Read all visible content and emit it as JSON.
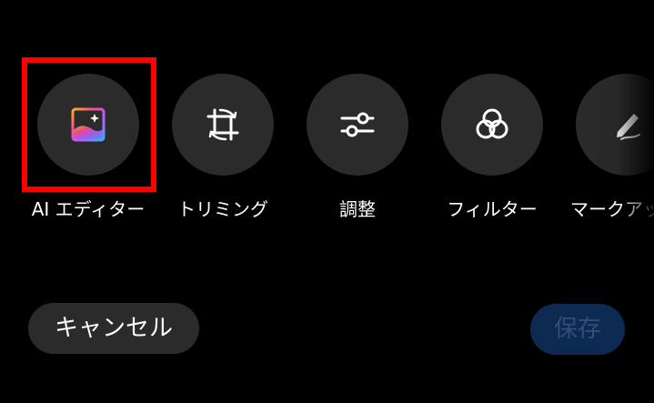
{
  "tools": [
    {
      "id": "ai-editor",
      "label": "AI エディター",
      "icon": "ai-image-sparkle-icon",
      "selected": true
    },
    {
      "id": "trimming",
      "label": "トリミング",
      "icon": "crop-rotate-icon"
    },
    {
      "id": "adjust",
      "label": "調整",
      "icon": "sliders-icon"
    },
    {
      "id": "filter",
      "label": "フィルター",
      "icon": "filter-circles-icon"
    },
    {
      "id": "markup",
      "label": "マークアップ",
      "icon": "pen-icon"
    }
  ],
  "actions": {
    "cancel_label": "キャンセル",
    "save_label": "保存"
  },
  "colors": {
    "background": "#000000",
    "tool_circle": "#2b2b2b",
    "highlight": "#ff0000",
    "save_bg": "#0c2a52",
    "save_text": "#2f4f78"
  }
}
